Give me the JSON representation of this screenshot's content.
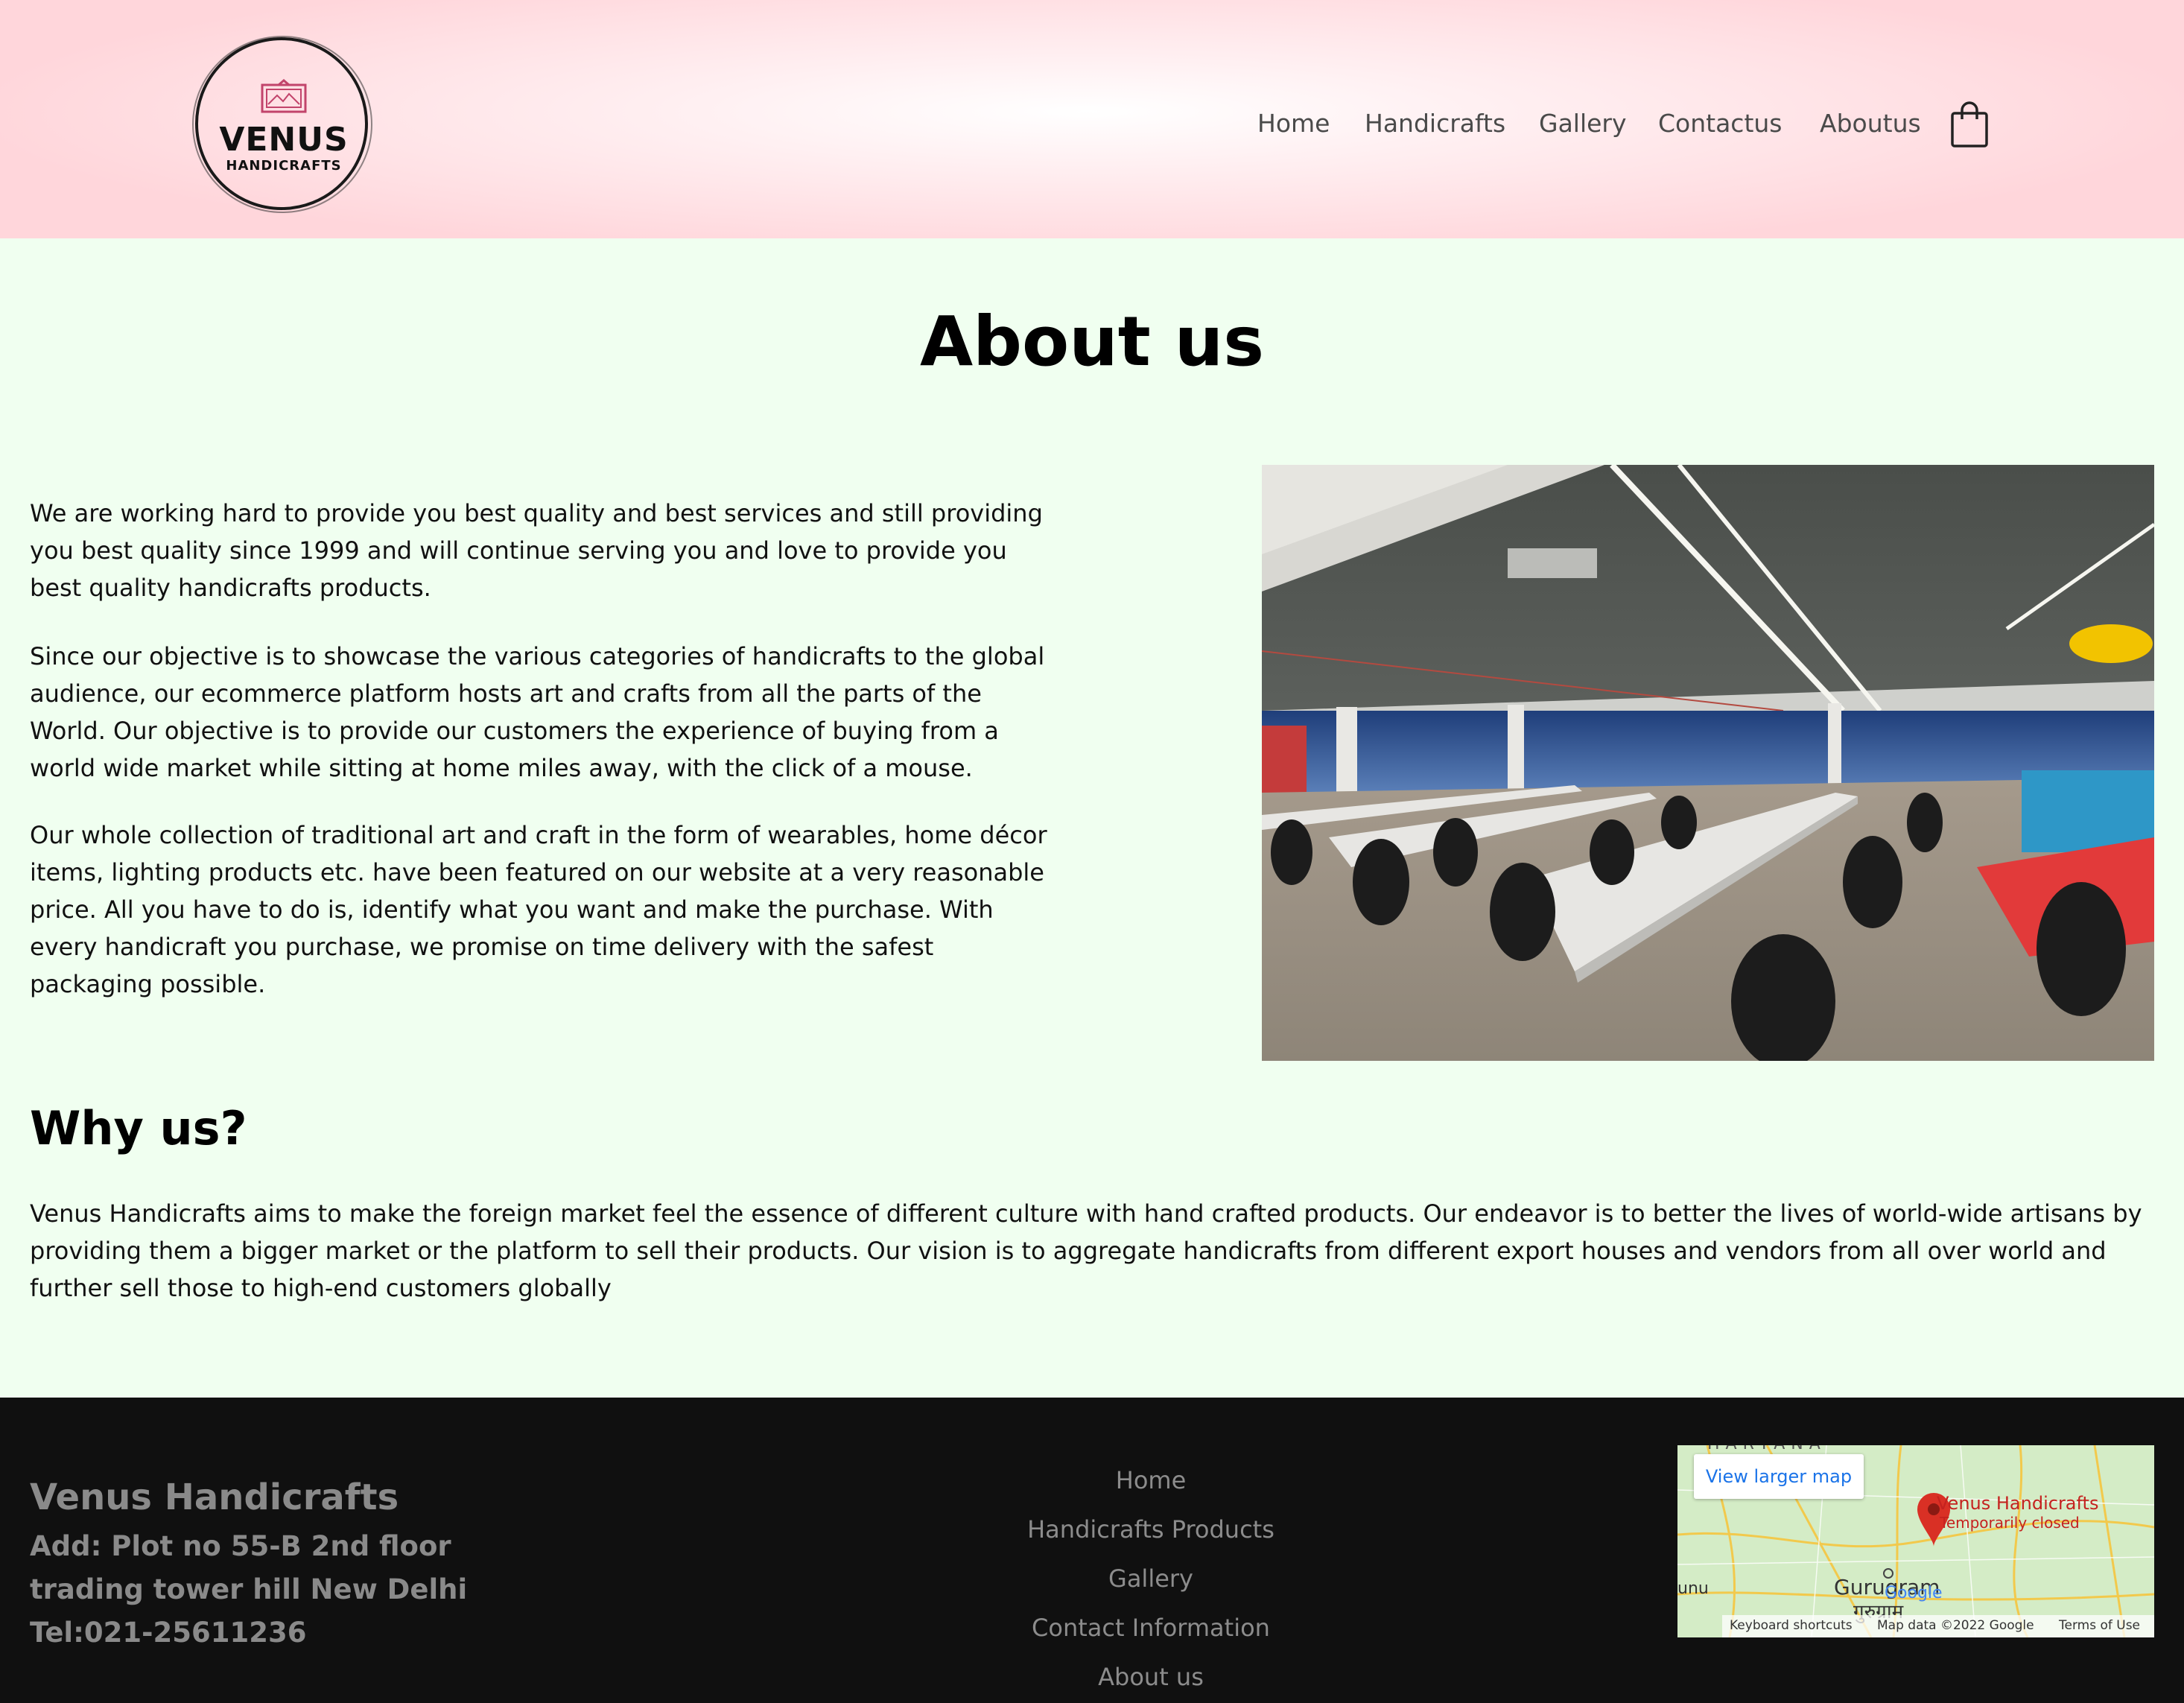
{
  "header": {
    "logo_title": "VENUS",
    "logo_subtitle": "HANDICRAFTS",
    "nav": [
      "Home",
      "Handicrafts",
      "Gallery",
      "Contactus",
      "Aboutus"
    ]
  },
  "main": {
    "title": "About us",
    "paragraphs": [
      "We are working hard to provide you best quality and best services and still providing you best quality since 1999 and will continue serving you and love to provide you best quality handicrafts products.",
      "Since our objective is to showcase the various categories of handicrafts to the global audience, our ecommerce platform hosts art and crafts from all the parts of the World. Our objective is to provide our customers the experience of buying from a world wide market while sitting at home miles away, with the click of a mouse.",
      "Our whole collection of traditional art and craft in the form of wearables, home décor items, lighting products etc. have been featured on our website at a very reasonable price. All you have to do is, identify what you want and make the purchase. With every handicraft you purchase, we promise on time delivery with the safest packaging possible."
    ],
    "why_title": "Why us?",
    "why_text": "Venus Handicrafts aims to make the foreign market feel the essence of different culture with hand crafted products. Our endeavor is to better the lives of world-wide artisans by providing them a bigger market or the platform to sell their products. Our vision is to aggregate handicrafts from different export houses and vendors from all over world and further sell those to high-end customers globally"
  },
  "footer": {
    "brand": "Venus Handicrafts",
    "address_line1": "Add: Plot no 55-B 2nd floor",
    "address_line2": "trading tower hill New Delhi",
    "tel": "Tel:021-25611236",
    "links": [
      "Home",
      "Handicrafts Products",
      "Gallery",
      "Contact Information",
      "About us"
    ],
    "map": {
      "view_larger": "View larger map",
      "place_name": "Venus Handicrafts",
      "place_status": "Temporarily closed",
      "city": "Gurugram",
      "city_hindi": "गुरुग्राम",
      "region_partial": "HARYANA",
      "left_edge_label": "unu",
      "attribution_shortcuts": "Keyboard shortcuts",
      "attribution_data": "Map data ©2022 Google",
      "attribution_terms": "Terms of Use",
      "google": "Google"
    }
  },
  "colors": {
    "header_pink": "#ffd6db",
    "page_bg": "#f0fff0",
    "footer_bg": "#101010",
    "footer_text": "#8a8a8a",
    "logo_frame": "#c2446b",
    "map_pin": "#d93025"
  }
}
